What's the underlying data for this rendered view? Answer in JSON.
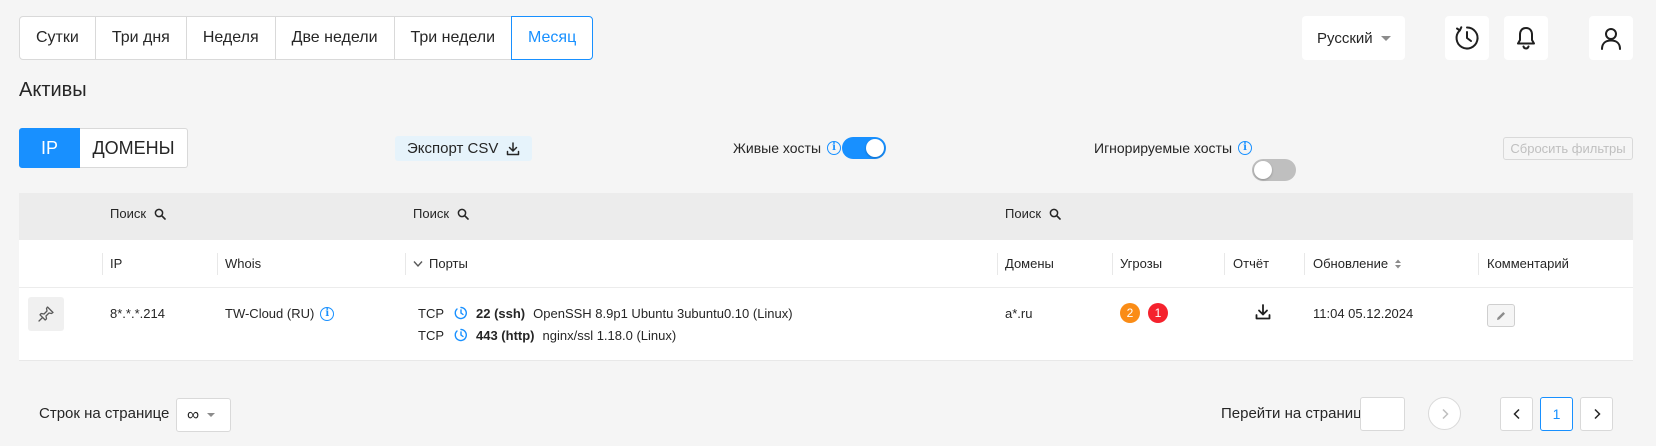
{
  "periods": [
    "Сутки",
    "Три дня",
    "Неделя",
    "Две недели",
    "Три недели",
    "Месяц"
  ],
  "active_period": "Месяц",
  "language": "Русский",
  "title": "Активы",
  "type_switch": {
    "ip": "IP",
    "domains": "ДОМЕНЫ",
    "active": "IP"
  },
  "export_label": "Экспорт CSV",
  "live_hosts": {
    "label": "Живые хосты",
    "on": true
  },
  "ignored_hosts": {
    "label": "Игнорируемые хосты",
    "on": false
  },
  "reset_filters": "Сбросить фильтры",
  "search_placeholder": "Поиск",
  "columns": {
    "ip": "IP",
    "whois": "Whois",
    "ports": "Порты",
    "domains": "Домены",
    "threats": "Угрозы",
    "report": "Отчёт",
    "updated": "Обновление",
    "comment": "Комментарий"
  },
  "rows": [
    {
      "ip": "8*.*.*.214",
      "whois": "TW-Cloud (RU)",
      "ports": [
        {
          "proto": "TCP",
          "port": "22 (ssh)",
          "service": "OpenSSH 8.9p1 Ubuntu 3ubuntu0.10 (Linux)"
        },
        {
          "proto": "TCP",
          "port": "443 (http)",
          "service": "nginx/ssl 1.18.0 (Linux)"
        }
      ],
      "domain": "a*.ru",
      "threats": {
        "medium": "2",
        "high": "1"
      },
      "updated": "11:04 05.12.2024"
    }
  ],
  "footer": {
    "rows_per_page_label": "Строк на странице",
    "rows_per_page_value": "∞",
    "goto_label": "Перейти на страницу",
    "current_page": "1"
  },
  "colors": {
    "accent": "#1890ff",
    "threat_medium": "#fa8c16",
    "threat_high": "#f5222d"
  }
}
